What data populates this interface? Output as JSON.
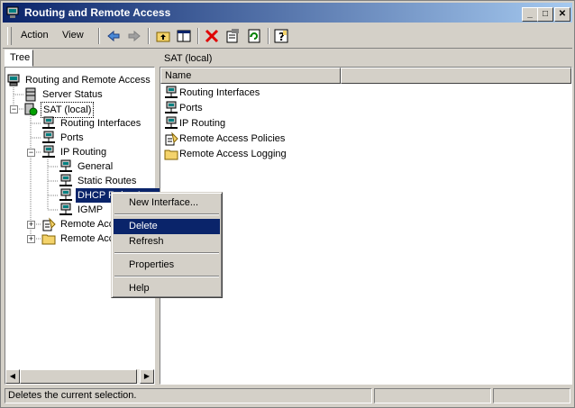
{
  "window": {
    "title": "Routing and Remote Access",
    "minimize": "_",
    "maximize": "□",
    "close": "✕"
  },
  "menubar": {
    "action": "Action",
    "view": "View"
  },
  "left_pane": {
    "tab": "Tree"
  },
  "tree": [
    {
      "label": "Routing and Remote Access",
      "icon": "computer-icon"
    },
    {
      "label": "Server Status",
      "icon": "server-stack-icon"
    },
    {
      "label": "SAT (local)",
      "icon": "server-green-icon"
    },
    {
      "label": "Routing Interfaces",
      "icon": "network-icon"
    },
    {
      "label": "Ports",
      "icon": "network-icon"
    },
    {
      "label": "IP Routing",
      "icon": "network-icon"
    },
    {
      "label": "General",
      "icon": "network-icon"
    },
    {
      "label": "Static Routes",
      "icon": "network-icon"
    },
    {
      "label": "DHCP Relay Agent",
      "icon": "network-icon"
    },
    {
      "label": "IGMP",
      "icon": "network-icon"
    },
    {
      "label": "Remote Access Policies",
      "icon": "policy-icon"
    },
    {
      "label": "Remote Access Logging",
      "icon": "folder-icon"
    }
  ],
  "right_pane": {
    "header": "SAT (local)",
    "column": "Name",
    "items": [
      {
        "label": "Routing Interfaces",
        "icon": "network-icon"
      },
      {
        "label": "Ports",
        "icon": "network-icon"
      },
      {
        "label": "IP Routing",
        "icon": "network-icon"
      },
      {
        "label": "Remote Access Policies",
        "icon": "policy-icon"
      },
      {
        "label": "Remote Access Logging",
        "icon": "folder-icon"
      }
    ]
  },
  "context_menu": {
    "new_interface": "New Interface...",
    "delete": "Delete",
    "refresh": "Refresh",
    "properties": "Properties",
    "help": "Help"
  },
  "status": {
    "text": "Deletes the current selection."
  },
  "colors": {
    "selection": "#0a246a",
    "face": "#d4d0c8",
    "delete_red": "#e00000",
    "folder": "#f4d36b"
  }
}
